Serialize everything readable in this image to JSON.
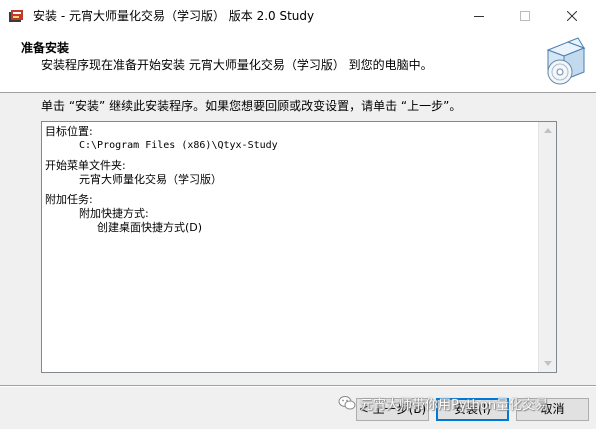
{
  "window": {
    "title": "安装 - 元宵大师量化交易（学习版） 版本 2.0 Study"
  },
  "header": {
    "title": "准备安装",
    "subtitle": "安装程序现在准备开始安装 元宵大师量化交易（学习版） 到您的电脑中。"
  },
  "body": {
    "instruction": "单击 “安装” 继续此安装程序。如果您想要回顾或改变设置，请单击 “上一步”。",
    "summary": {
      "dest_label": "目标位置:",
      "dest_value": "C:\\Program Files (x86)\\Qtyx-Study",
      "menu_label": "开始菜单文件夹:",
      "menu_value": "元宵大师量化交易（学习版）",
      "tasks_label": "附加任务:",
      "tasks_group": "附加快捷方式:",
      "tasks_item": "创建桌面快捷方式(D)"
    }
  },
  "footer": {
    "back_label": "< 上一步(B)",
    "install_label": "安装(I)",
    "cancel_label": "取消"
  },
  "watermark": {
    "text": "元宵大师带你用Python量化交易"
  },
  "colors": {
    "window_bg": "#f0f0f0",
    "accent": "#0078d7",
    "button_bg": "#e1e1e1"
  },
  "icons": {
    "app": "setup-app-icon",
    "header_graphic": "install-box-disc-icon",
    "watermark": "wechat-icon"
  }
}
